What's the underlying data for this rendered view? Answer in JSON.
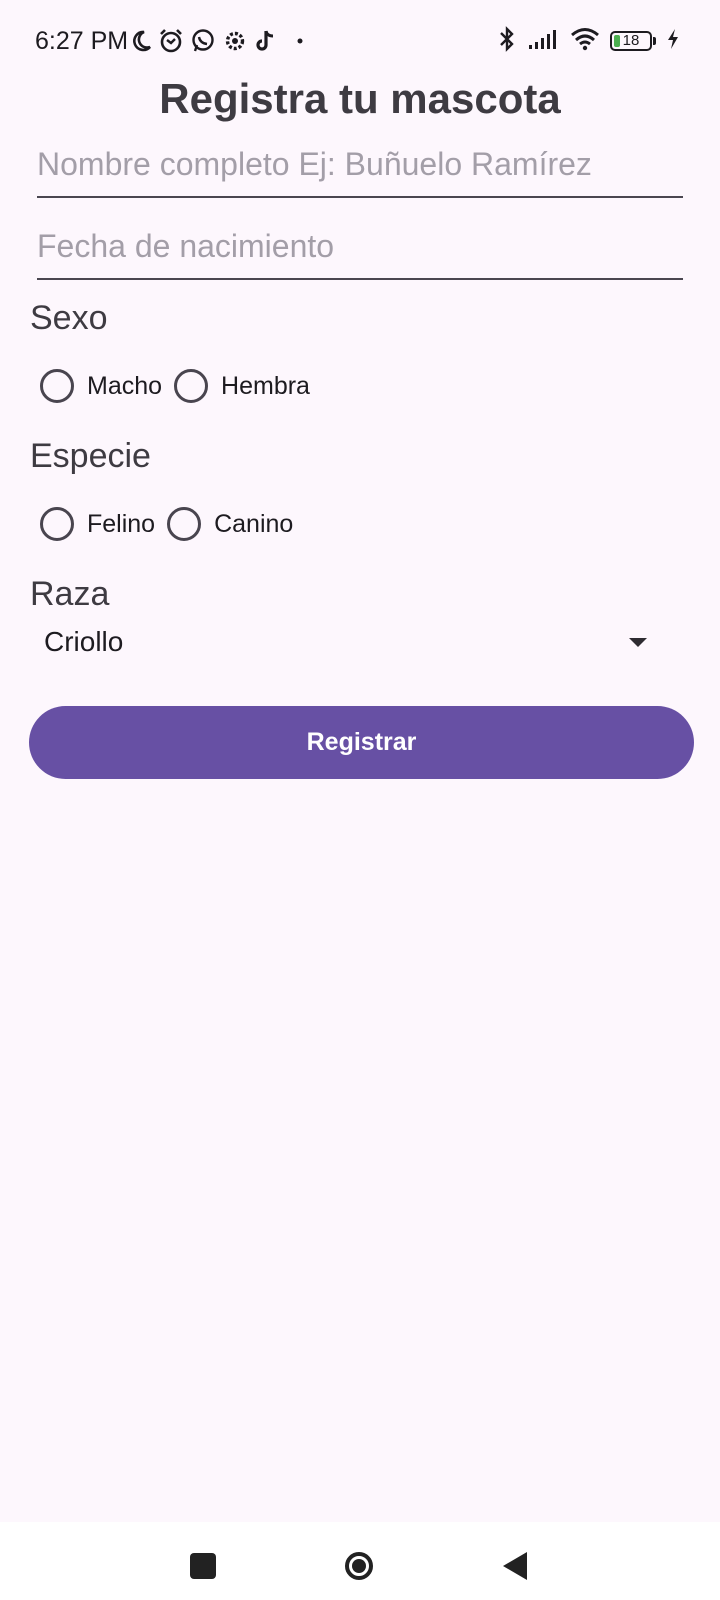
{
  "status_bar": {
    "time": "6:27 PM",
    "left_icons": [
      "moon-icon",
      "alarm-icon",
      "whatsapp-icon",
      "settings-icon",
      "tiktok-icon",
      "dot-icon"
    ],
    "right_icons": [
      "bluetooth-icon",
      "signal-icon",
      "wifi-icon",
      "battery-icon",
      "charging-icon"
    ],
    "battery_level": "18",
    "battery_color": "#4caf50"
  },
  "form": {
    "title": "Registra tu mascota",
    "name_field": {
      "placeholder": "Nombre completo Ej: Buñuelo Ramírez",
      "value": ""
    },
    "date_field": {
      "placeholder": "Fecha de nacimiento",
      "value": ""
    },
    "sex": {
      "label": "Sexo",
      "options": [
        "Macho",
        "Hembra"
      ],
      "selected": null
    },
    "species": {
      "label": "Especie",
      "options": [
        "Felino",
        "Canino"
      ],
      "selected": null
    },
    "breed": {
      "label": "Raza",
      "selected": "Criollo"
    },
    "submit_label": "Registrar"
  },
  "colors": {
    "background": "#fdf7fd",
    "primary": "#6750a4",
    "on_primary": "#ffffff"
  },
  "nav_bar": {
    "buttons": [
      "recents-icon",
      "home-icon",
      "back-icon"
    ]
  }
}
